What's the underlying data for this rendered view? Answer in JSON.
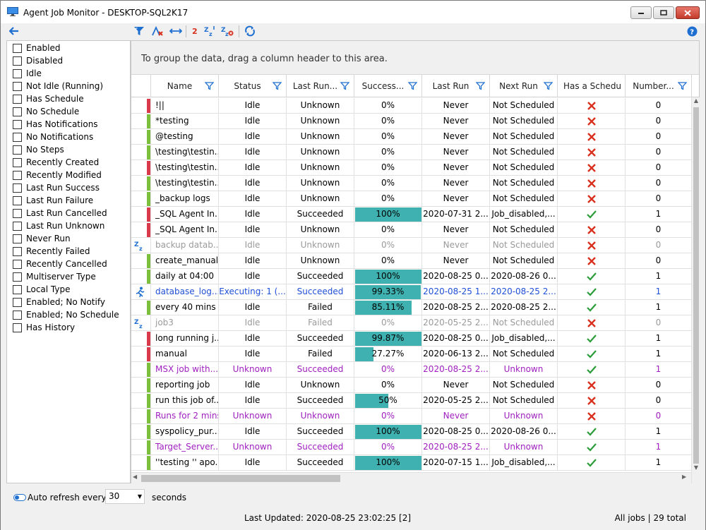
{
  "window": {
    "title": "Agent Job Monitor - DESKTOP-SQL2K17"
  },
  "toolbar": {
    "icons": [
      "back-arrow-icon",
      "filter-icon",
      "clear-filter-icon",
      "expand-icon",
      "red-2-icon",
      "sort-sleep-icon",
      "sleep-cancel-icon",
      "refresh-icon",
      "help-icon"
    ],
    "badge_value": "2"
  },
  "filters": [
    "Enabled",
    "Disabled",
    "Idle",
    "Not Idle (Running)",
    "Has Schedule",
    "No Schedule",
    "Has Notifications",
    "No Notifications",
    "No Steps",
    "Recently Created",
    "Recently Modified",
    "Last Run Success",
    "Last Run Failure",
    "Last Run Cancelled",
    "Last Run Unknown",
    "Never Run",
    "Recently Failed",
    "Recently Cancelled",
    "Multiserver Type",
    "Local Type",
    "Enabled; No Notify",
    "Enabled; No Schedule",
    "Has History"
  ],
  "group_hint": "To group the data, drag a column header to this area.",
  "columns": [
    "Name",
    "Status",
    "Last Run...",
    "Success...",
    "Last Run",
    "Next Run",
    "Has a Schedule",
    "Number..."
  ],
  "colors": {
    "red_state": "#d9394a",
    "green_state": "#7cbf3d",
    "progress": "#3fb1b0",
    "blue_text": "#1f4fd6",
    "purple_text": "#a020c0",
    "gray_text": "#9a9a9a",
    "check": "#2a9d3a",
    "cross": "#d8311f"
  },
  "rows": [
    {
      "state": "red",
      "icon": "",
      "style": "normal",
      "name": "!||",
      "status": "Idle",
      "outcome": "Unknown",
      "success": "0%",
      "pct": 0,
      "last_run": "Never",
      "next_run": "Not Scheduled",
      "schedule": false,
      "number": "0"
    },
    {
      "state": "green",
      "icon": "",
      "style": "normal",
      "name": "*testing",
      "status": "Idle",
      "outcome": "Unknown",
      "success": "0%",
      "pct": 0,
      "last_run": "Never",
      "next_run": "Not Scheduled",
      "schedule": false,
      "number": "0"
    },
    {
      "state": "green",
      "icon": "",
      "style": "normal",
      "name": "@testing",
      "status": "Idle",
      "outcome": "Unknown",
      "success": "0%",
      "pct": 0,
      "last_run": "Never",
      "next_run": "Not Scheduled",
      "schedule": false,
      "number": "0"
    },
    {
      "state": "green",
      "icon": "",
      "style": "normal",
      "name": "\\testing\\testin...",
      "status": "Idle",
      "outcome": "Unknown",
      "success": "0%",
      "pct": 0,
      "last_run": "Never",
      "next_run": "Not Scheduled",
      "schedule": false,
      "number": "0"
    },
    {
      "state": "red",
      "icon": "",
      "style": "normal",
      "name": "\\testing\\testin...",
      "status": "Idle",
      "outcome": "Unknown",
      "success": "0%",
      "pct": 0,
      "last_run": "Never",
      "next_run": "Not Scheduled",
      "schedule": false,
      "number": "0"
    },
    {
      "state": "green",
      "icon": "",
      "style": "normal",
      "name": "\\testing\\testin...",
      "status": "Idle",
      "outcome": "Unknown",
      "success": "0%",
      "pct": 0,
      "last_run": "Never",
      "next_run": "Not Scheduled",
      "schedule": false,
      "number": "0"
    },
    {
      "state": "green",
      "icon": "",
      "style": "normal",
      "name": "_backup logs",
      "status": "Idle",
      "outcome": "Unknown",
      "success": "0%",
      "pct": 0,
      "last_run": "Never",
      "next_run": "Not Scheduled",
      "schedule": false,
      "number": "0"
    },
    {
      "state": "red",
      "icon": "",
      "style": "normal",
      "name": "_SQL Agent In...",
      "status": "Idle",
      "outcome": "Succeeded",
      "success": "100%",
      "pct": 100,
      "last_run": "2020-07-31 2...",
      "next_run": "Job_disabled,...",
      "schedule": true,
      "number": "1"
    },
    {
      "state": "red",
      "icon": "",
      "style": "normal",
      "name": "_SQL Agent In...",
      "status": "Idle",
      "outcome": "Unknown",
      "success": "0%",
      "pct": 0,
      "last_run": "Never",
      "next_run": "Not Scheduled",
      "schedule": false,
      "number": "0"
    },
    {
      "state": "none",
      "icon": "sleep",
      "style": "gray",
      "name": "backup datab...",
      "status": "Idle",
      "outcome": "Unknown",
      "success": "0%",
      "pct": 0,
      "last_run": "Never",
      "next_run": "Not Scheduled",
      "schedule": false,
      "number": "0"
    },
    {
      "state": "green",
      "icon": "",
      "style": "normal",
      "name": "create_manual...",
      "status": "Idle",
      "outcome": "Unknown",
      "success": "0%",
      "pct": 0,
      "last_run": "Never",
      "next_run": "Not Scheduled",
      "schedule": false,
      "number": "0"
    },
    {
      "state": "green",
      "icon": "",
      "style": "normal",
      "name": "daily at 04:00",
      "status": "Idle",
      "outcome": "Succeeded",
      "success": "100%",
      "pct": 100,
      "last_run": "2020-08-25 0...",
      "next_run": "2020-08-26 0...",
      "schedule": true,
      "number": "1"
    },
    {
      "state": "none",
      "icon": "run",
      "style": "blue",
      "name": "database_log...",
      "status": "Executing: 1 (...",
      "outcome": "Succeeded",
      "success": "99.33%",
      "pct": 99.33,
      "last_run": "2020-08-25 1...",
      "next_run": "2020-08-25 2...",
      "schedule": true,
      "number": "1"
    },
    {
      "state": "green",
      "icon": "",
      "style": "normal",
      "name": "every 40 mins",
      "status": "Idle",
      "outcome": "Failed",
      "success": "85.11%",
      "pct": 85.11,
      "last_run": "2020-08-25 2...",
      "next_run": "2020-08-25 2...",
      "schedule": true,
      "number": "1"
    },
    {
      "state": "none",
      "icon": "sleep",
      "style": "gray",
      "name": "job3",
      "status": "Idle",
      "outcome": "Failed",
      "success": "0%",
      "pct": 0,
      "last_run": "2020-05-25 2...",
      "next_run": "Not Scheduled",
      "schedule": false,
      "number": "0"
    },
    {
      "state": "red",
      "icon": "",
      "style": "normal",
      "name": "long running j...",
      "status": "Idle",
      "outcome": "Succeeded",
      "success": "99.87%",
      "pct": 99.87,
      "last_run": "2020-08-25 0...",
      "next_run": "Job_disabled,...",
      "schedule": true,
      "number": "1"
    },
    {
      "state": "red",
      "icon": "",
      "style": "normal",
      "name": "manual",
      "status": "Idle",
      "outcome": "Failed",
      "success": "27.27%",
      "pct": 27.27,
      "last_run": "2020-06-13 2...",
      "next_run": "Not Scheduled",
      "schedule": true,
      "number": "1"
    },
    {
      "state": "green",
      "icon": "",
      "style": "purple",
      "name": "MSX job with...",
      "status": "Unknown",
      "outcome": "Succeeded",
      "success": "0%",
      "pct": 0,
      "last_run": "2020-08-25 2...",
      "next_run": "Unknown",
      "schedule": true,
      "number": "1"
    },
    {
      "state": "green",
      "icon": "",
      "style": "normal",
      "name": "reporting job",
      "status": "Idle",
      "outcome": "Unknown",
      "success": "0%",
      "pct": 0,
      "last_run": "Never",
      "next_run": "Not Scheduled",
      "schedule": false,
      "number": "0"
    },
    {
      "state": "green",
      "icon": "",
      "style": "normal",
      "name": "run this job of...",
      "status": "Idle",
      "outcome": "Succeeded",
      "success": "50%",
      "pct": 50,
      "last_run": "2020-05-25 2...",
      "next_run": "Not Scheduled",
      "schedule": false,
      "number": "0"
    },
    {
      "state": "green",
      "icon": "",
      "style": "purple",
      "name": "Runs for 2 mins",
      "status": "Unknown",
      "outcome": "Unknown",
      "success": "0%",
      "pct": 0,
      "last_run": "Never",
      "next_run": "Unknown",
      "schedule": false,
      "number": "0"
    },
    {
      "state": "green",
      "icon": "",
      "style": "normal",
      "name": "syspolicy_pur...",
      "status": "Idle",
      "outcome": "Succeeded",
      "success": "100%",
      "pct": 100,
      "last_run": "2020-08-25 0...",
      "next_run": "2020-08-26 0...",
      "schedule": true,
      "number": "1"
    },
    {
      "state": "green",
      "icon": "",
      "style": "purple",
      "name": "Target_Server...",
      "status": "Unknown",
      "outcome": "Succeeded",
      "success": "0%",
      "pct": 0,
      "last_run": "2020-08-25 2...",
      "next_run": "Unknown",
      "schedule": true,
      "number": "1"
    },
    {
      "state": "green",
      "icon": "",
      "style": "normal",
      "name": "''testing '' apo...",
      "status": "Idle",
      "outcome": "Succeeded",
      "success": "100%",
      "pct": 100,
      "last_run": "2020-07-15 1...",
      "next_run": "Job_disabled,...",
      "schedule": true,
      "number": "1"
    }
  ],
  "bottom": {
    "auto_refresh_label": "Auto refresh every",
    "refresh_value": "30",
    "seconds_label": "seconds",
    "last_updated": "Last Updated: 2020-08-25 23:02:25 [2]",
    "totals": "All jobs | 29 total"
  }
}
